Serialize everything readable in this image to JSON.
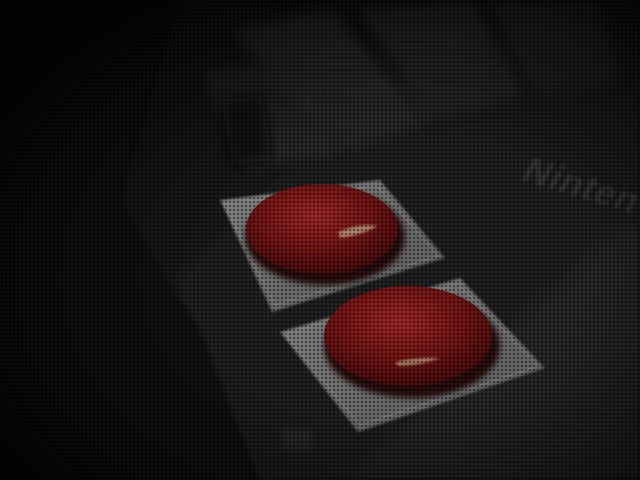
{
  "scene": {
    "description_label": "",
    "brand_text": "Ninten",
    "colors": {
      "background": "#0c0c0c",
      "controller_body": "#1e1e1e",
      "button_red": "#7a1010",
      "button_well": "#7a7a7a"
    }
  }
}
